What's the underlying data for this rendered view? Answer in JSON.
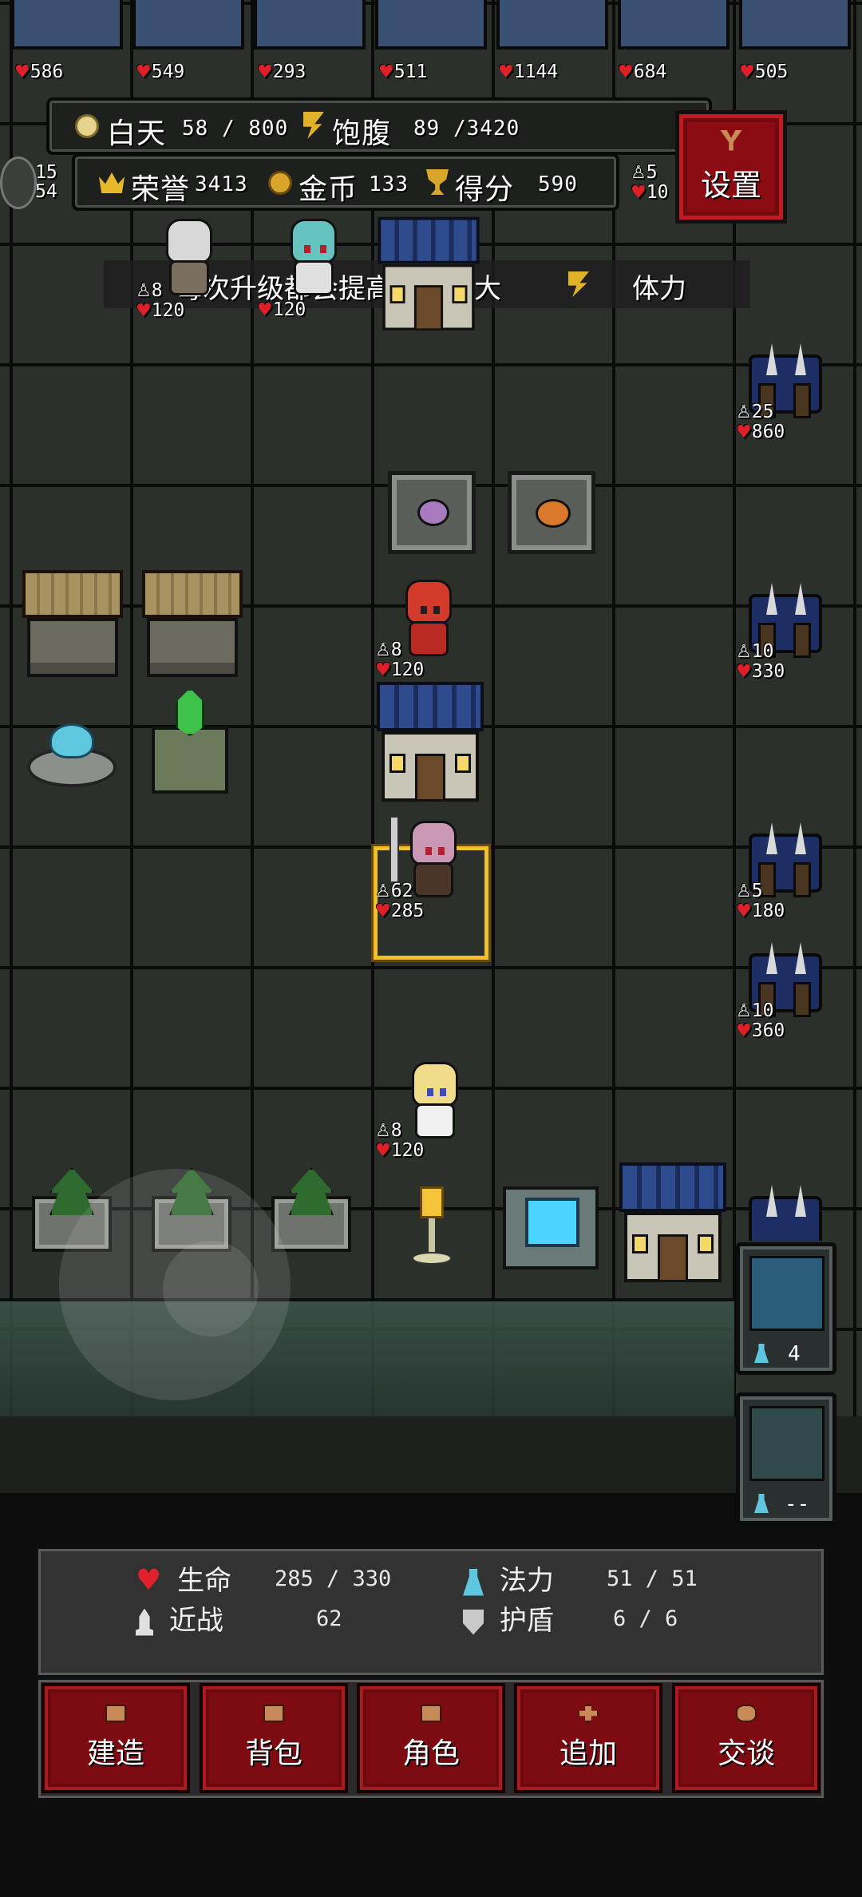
{
  "top_row_hp": [
    "586",
    "549",
    "293",
    "511",
    "1144",
    "684",
    "505"
  ],
  "resources": {
    "day_label": "白天",
    "day_value": "58 / 800",
    "satiety_label": "饱腹",
    "satiety_value": "89 /3420",
    "honor_label": "荣誉",
    "honor_value": "3413",
    "gold_label": "金币",
    "gold_value": "133",
    "score_label": "得分",
    "score_value": "590",
    "side_stat_top": "5",
    "side_stat_bottom": "10",
    "left_stat_top": "15",
    "left_stat_bottom": "54"
  },
  "settings_label": "设置",
  "tip": {
    "text": "每次升级都会提高你的最大",
    "highlight": "体力"
  },
  "units": [
    {
      "atk": "8",
      "hp": "120"
    },
    {
      "atk": "",
      "hp": "120"
    },
    {
      "atk": "8",
      "hp": "120"
    },
    {
      "atk": "62",
      "hp": "285"
    },
    {
      "atk": "8",
      "hp": "120"
    }
  ],
  "enemies": [
    {
      "atk": "25",
      "hp": "860"
    },
    {
      "atk": "10",
      "hp": "330"
    },
    {
      "atk": "5",
      "hp": "180"
    },
    {
      "atk": "10",
      "hp": "360"
    }
  ],
  "skills": [
    {
      "cost": "4"
    },
    {
      "cost": "--"
    }
  ],
  "player": {
    "life_label": "生命",
    "life_value": "285 / 330",
    "mana_label": "法力",
    "mana_value": "51 / 51",
    "melee_label": "近战",
    "melee_value": "62",
    "shield_label": "护盾",
    "shield_value": "6 / 6"
  },
  "actions": {
    "build": "建造",
    "backpack": "背包",
    "character": "角色",
    "add": "追加",
    "talk": "交谈"
  },
  "colors": {
    "heart": "#e0202a",
    "button_red": "#7d0c12",
    "selected_border": "#f2c02a"
  }
}
